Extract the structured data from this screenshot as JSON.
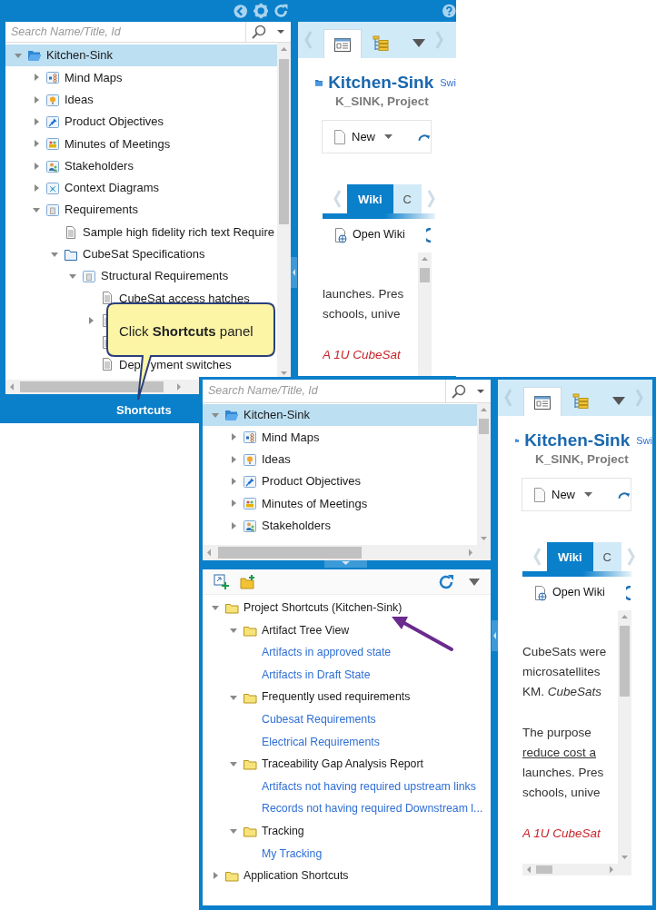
{
  "top_screenshot": {
    "search": {
      "placeholder": "Search Name/Title, Id"
    },
    "tree": [
      {
        "label": "Kitchen-Sink",
        "kind": "project",
        "expanded": true,
        "selected": true,
        "children": [
          {
            "label": "Mind Maps",
            "kind": "mindmap",
            "expanded": false,
            "selected": false
          },
          {
            "label": "Ideas",
            "kind": "idea",
            "expanded": false,
            "selected": false
          },
          {
            "label": "Product Objectives",
            "kind": "objective",
            "expanded": false,
            "selected": false
          },
          {
            "label": "Minutes of Meetings",
            "kind": "meeting",
            "expanded": false,
            "selected": false
          },
          {
            "label": "Stakeholders",
            "kind": "stakeholder",
            "expanded": false,
            "selected": false
          },
          {
            "label": "Context Diagrams",
            "kind": "diagram",
            "expanded": false,
            "selected": false
          },
          {
            "label": "Requirements",
            "kind": "module",
            "expanded": true,
            "selected": false,
            "children": [
              {
                "label": "Sample high fidelity rich text Require",
                "kind": "document",
                "selected": false
              },
              {
                "label": "CubeSat Specifications",
                "kind": "folder",
                "expanded": true,
                "selected": false,
                "children": [
                  {
                    "label": "Structural Requirements",
                    "kind": "module",
                    "expanded": true,
                    "selected": false,
                    "children": [
                      {
                        "label": "CubeSat access hatches",
                        "kind": "document",
                        "selected": false
                      },
                      {
                        "kind": "document",
                        "expanded": false,
                        "selected": false
                      },
                      {
                        "kind": "document",
                        "selected": false
                      },
                      {
                        "label": "Dep",
                        "label_after_cover": "yment switches",
                        "kind": "document",
                        "selected": false
                      }
                    ]
                  }
                ]
              }
            ]
          }
        ]
      }
    ],
    "panel_label": "Shortcuts",
    "details": {
      "view_tabs": [
        {
          "kind": "details",
          "selected": true
        },
        {
          "kind": "tree",
          "selected": false
        }
      ],
      "title": "Kitchen-Sink",
      "title_link": "Swi",
      "subtitle": "K_SINK, Project",
      "new_button": "New",
      "wiki_tabs": [
        {
          "label": "Wiki",
          "selected": true
        },
        {
          "label": "C",
          "selected": false
        }
      ],
      "open_wiki": "Open Wiki",
      "paragraphs": [
        {
          "lines": [
            {
              "text": "launches. Pres",
              "kind": "plain"
            },
            {
              "text": "schools, unive",
              "kind": "plain"
            }
          ]
        },
        {
          "lines": [
            {
              "text": "A 1U CubeSat",
              "kind": "red_italic"
            }
          ]
        }
      ]
    }
  },
  "bottom_screenshot": {
    "search": {
      "placeholder": "Search Name/Title, Id"
    },
    "tree": [
      {
        "label": "Kitchen-Sink",
        "kind": "project",
        "expanded": true,
        "selected": true,
        "children": [
          {
            "label": "Mind Maps",
            "kind": "mindmap",
            "expanded": false,
            "selected": false
          },
          {
            "label": "Ideas",
            "kind": "idea",
            "expanded": false,
            "selected": false
          },
          {
            "label": "Product Objectives",
            "kind": "objective",
            "expanded": false,
            "selected": false
          },
          {
            "label": "Minutes of Meetings",
            "kind": "meeting",
            "expanded": false,
            "selected": false
          },
          {
            "label": "Stakeholders",
            "kind": "stakeholder",
            "expanded": false,
            "selected": false
          }
        ]
      }
    ],
    "shortcuts": [
      {
        "label": "Project Shortcuts (Kitchen-Sink)",
        "kind": "shortcut_folder",
        "expanded": true,
        "children": [
          {
            "label": "Artifact Tree View",
            "kind": "shortcut_folder",
            "expanded": true,
            "children": [
              {
                "label": "Artifacts in approved state",
                "kind": "link"
              },
              {
                "label": "Artifacts in Draft State",
                "kind": "link"
              }
            ]
          },
          {
            "label": "Frequently used requirements",
            "kind": "shortcut_folder",
            "expanded": true,
            "children": [
              {
                "label": "Cubesat Requirements",
                "kind": "link"
              },
              {
                "label": "Electrical Requirements",
                "kind": "link"
              }
            ]
          },
          {
            "label": "Traceability Gap Analysis Report",
            "kind": "shortcut_folder",
            "expanded": true,
            "children": [
              {
                "label": "Artifacts not having required upstream links",
                "kind": "link"
              },
              {
                "label": "Records not having required Downstream l...",
                "kind": "link"
              }
            ]
          },
          {
            "label": "Tracking",
            "kind": "shortcut_folder",
            "expanded": true,
            "children": [
              {
                "label": "My Tracking",
                "kind": "link"
              }
            ]
          }
        ]
      },
      {
        "label": "Application Shortcuts",
        "kind": "shortcut_folder",
        "expanded": false
      }
    ],
    "details": {
      "view_tabs": [
        {
          "kind": "details",
          "selected": true
        },
        {
          "kind": "tree",
          "selected": false
        }
      ],
      "title": "Kitchen-Sink",
      "title_link": "Swi",
      "subtitle": "K_SINK, Project",
      "new_button": "New",
      "wiki_tabs": [
        {
          "label": "Wiki",
          "selected": true
        },
        {
          "label": "C",
          "selected": false
        }
      ],
      "open_wiki": "Open Wiki",
      "paragraphs": [
        {
          "lines": [
            {
              "text": "CubeSats were",
              "kind": "plain"
            },
            {
              "text": "microsatellites",
              "kind": "plain"
            },
            {
              "text": "KM. *CubeSats*",
              "kind": "plain"
            }
          ]
        },
        {
          "lines": [
            {
              "text": "The purpose",
              "kind": "plain"
            },
            {
              "text": "reduce cost a",
              "kind": "underline"
            },
            {
              "text": "launches. Pres",
              "kind": "plain"
            },
            {
              "text": "schools, unive",
              "kind": "plain"
            }
          ]
        },
        {
          "lines": [
            {
              "text": "A 1U CubeSat",
              "kind": "red_italic"
            }
          ]
        }
      ]
    }
  },
  "callout": {
    "text": "Click **Shortcuts** panel"
  }
}
